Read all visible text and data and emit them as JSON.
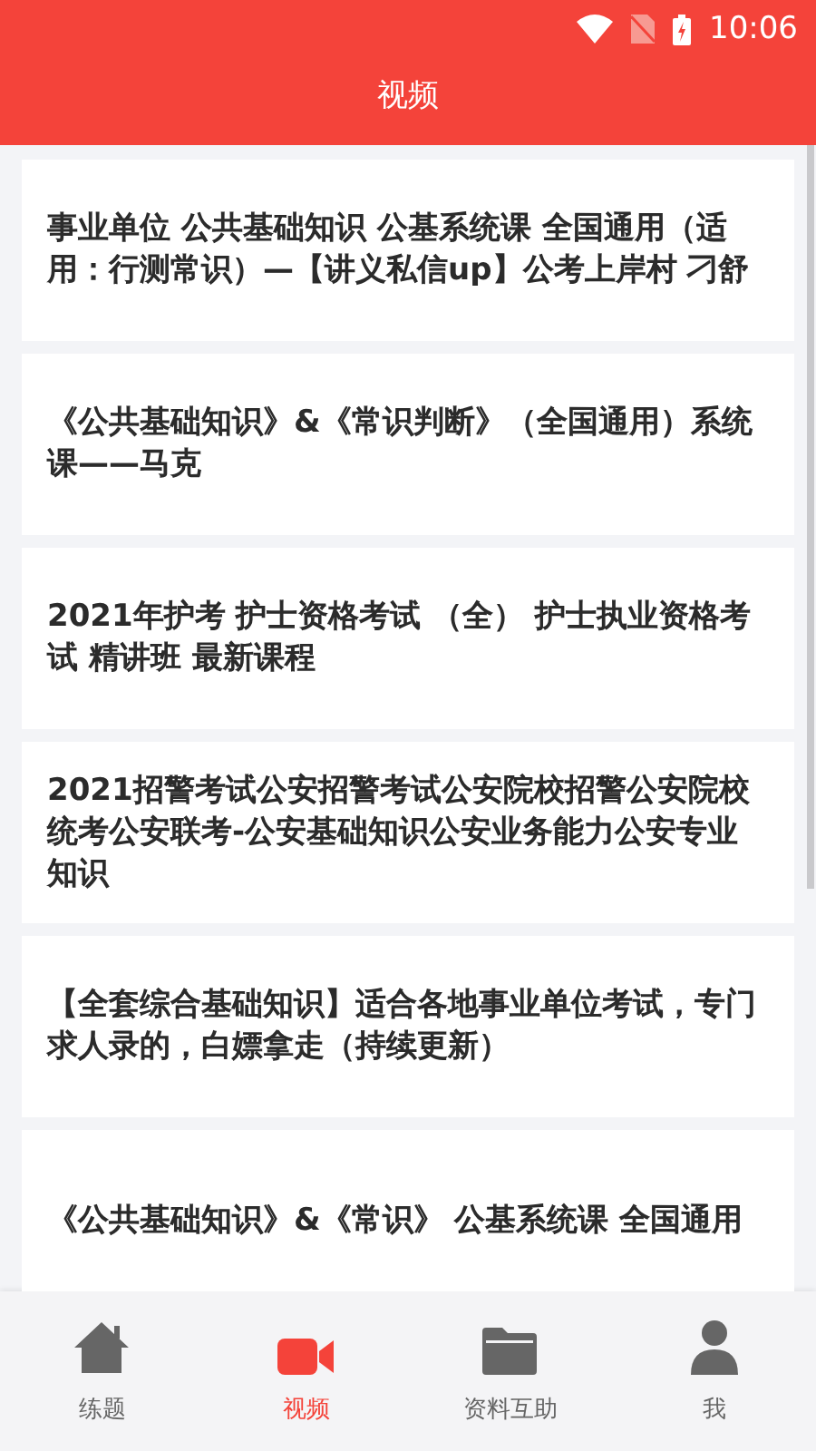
{
  "status_bar": {
    "time": "10:06"
  },
  "header": {
    "title": "视频"
  },
  "videos": [
    {
      "title": "事业单位 公共基础知识 公基系统课 全国通用（适用：行测常识）—【讲义私信up】公考上岸村 刁舒"
    },
    {
      "title": "《公共基础知识》&《常识判断》（全国通用）系统课——马克"
    },
    {
      "title": "2021年护考 护士资格考试 （全） 护士执业资格考试 精讲班 最新课程"
    },
    {
      "title": "2021招警考试公安招警考试公安院校招警公安院校统考公安联考-公安基础知识公安业务能力公安专业知识"
    },
    {
      "title": "【全套综合基础知识】适合各地事业单位考试，专门求人录的，白嫖拿走（持续更新）"
    },
    {
      "title": "《公共基础知识》&《常识》 公基系统课 全国通用"
    }
  ],
  "tabs": [
    {
      "label": "练题",
      "kind": "home",
      "selected": false
    },
    {
      "label": "视频",
      "kind": "video",
      "selected": true
    },
    {
      "label": "资料互助",
      "kind": "folder",
      "selected": false
    },
    {
      "label": "我",
      "kind": "person",
      "selected": false
    }
  ]
}
